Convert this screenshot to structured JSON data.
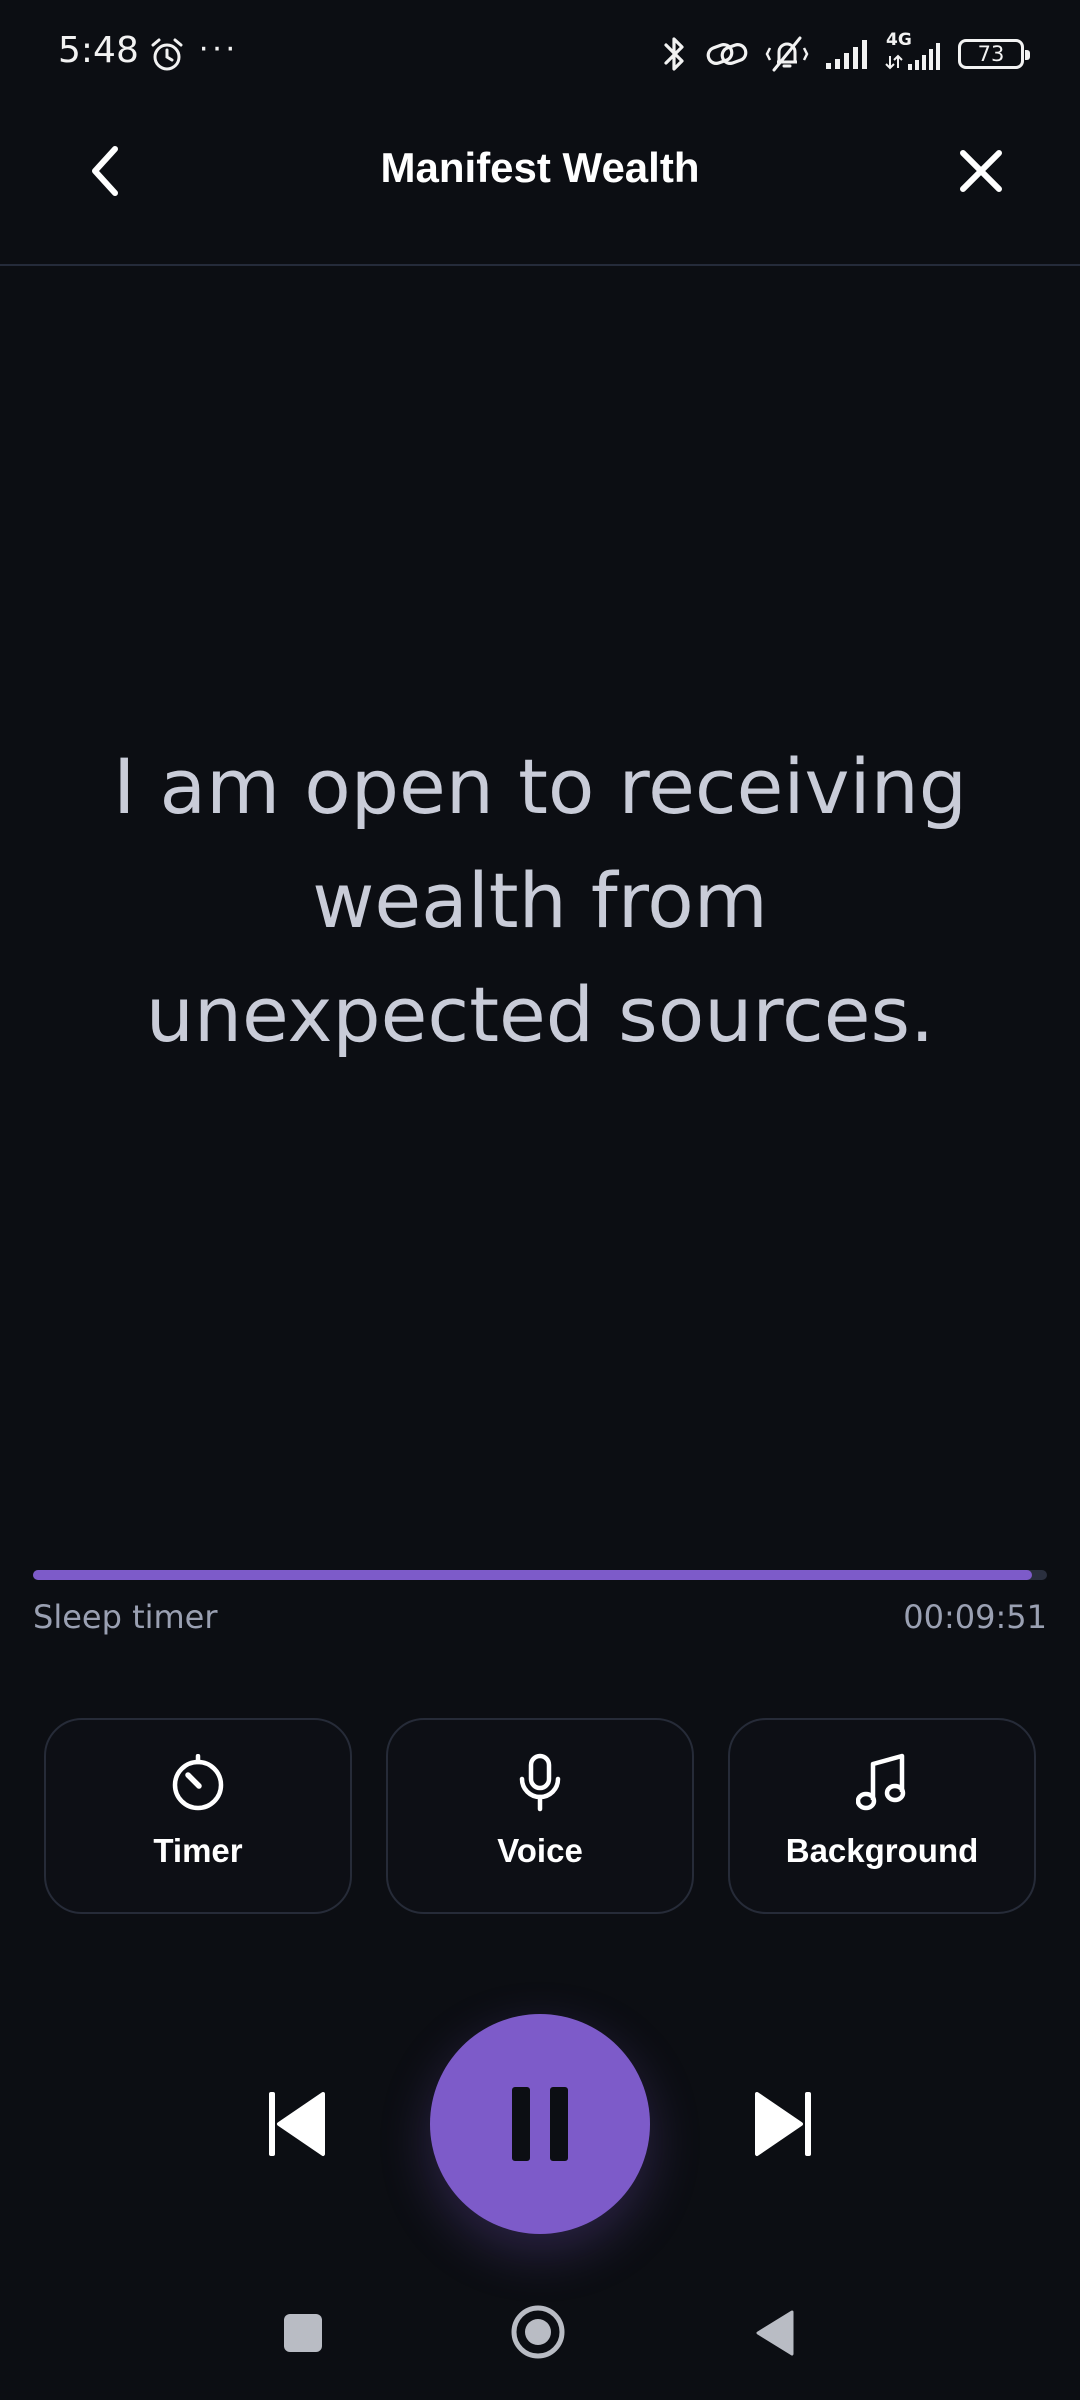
{
  "status_bar": {
    "time": "5:48",
    "more_indicator": "···",
    "network": "4G",
    "battery_level": "73",
    "icons": [
      "alarm-icon",
      "bluetooth-icon",
      "link-icon",
      "vibrate-off-icon",
      "signal-icon",
      "signal-4g-icon",
      "battery-icon"
    ]
  },
  "header": {
    "title": "Manifest Wealth",
    "back_icon": "chevron-left-icon",
    "close_icon": "close-icon"
  },
  "affirmation": {
    "text": "I am open to receiving wealth from unexpected sources."
  },
  "progress": {
    "fraction": 0.985,
    "label": "Sleep timer",
    "time_remaining": "00:09:51"
  },
  "options": [
    {
      "label": "Timer",
      "icon": "timer-icon"
    },
    {
      "label": "Voice",
      "icon": "microphone-icon"
    },
    {
      "label": "Background",
      "icon": "music-note-icon"
    }
  ],
  "playback": {
    "state": "playing",
    "icons": [
      "skip-previous-icon",
      "pause-icon",
      "skip-next-icon"
    ]
  },
  "colors": {
    "background": "#0c0e13",
    "accent": "#7d5bc9",
    "affirmation_text": "#c9ccd8",
    "secondary_text": "#9aa0b2",
    "card_border": "#262b38"
  }
}
